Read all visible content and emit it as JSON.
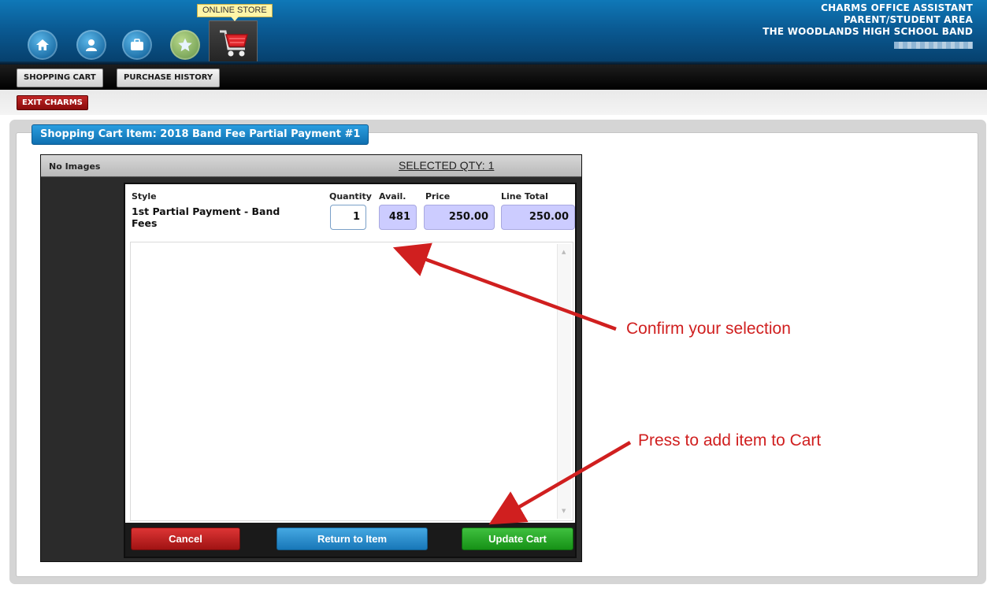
{
  "header": {
    "tooltip": "ONLINE STORE",
    "org_line1": "CHARMS OFFICE ASSISTANT",
    "org_line2": "PARENT/STUDENT AREA",
    "org_line3": "THE WOODLANDS HIGH SCHOOL BAND",
    "nav_icons": [
      "home-icon",
      "user-icon",
      "briefcase-icon",
      "star-icon",
      "shopping-cart-icon"
    ]
  },
  "tabs": [
    "SHOPPING CART",
    "PURCHASE HISTORY"
  ],
  "exit_label": "EXIT CHARMS",
  "section_title": "Shopping Cart Item: 2018 Band Fee Partial Payment #1",
  "dialog": {
    "no_images": "No Images",
    "selected_qty": "SELECTED QTY: 1",
    "columns": {
      "style": "Style",
      "quantity": "Quantity",
      "avail": "Avail.",
      "price": "Price",
      "line_total": "Line Total"
    },
    "row": {
      "style": "1st Partial Payment - Band Fees",
      "quantity": "1",
      "avail": "481",
      "price": "250.00",
      "line_total": "250.00"
    },
    "buttons": {
      "cancel": "Cancel",
      "return": "Return to Item",
      "update": "Update Cart"
    }
  },
  "annotations": {
    "confirm": "Confirm your selection",
    "press": "Press to add item to Cart",
    "color": "#d01f1f"
  },
  "colors": {
    "header_blue": "#0a5a93",
    "readonly_field": "#ccccff",
    "cancel_red": "#c62020",
    "return_blue": "#2a8ed0",
    "update_green": "#22a322"
  }
}
